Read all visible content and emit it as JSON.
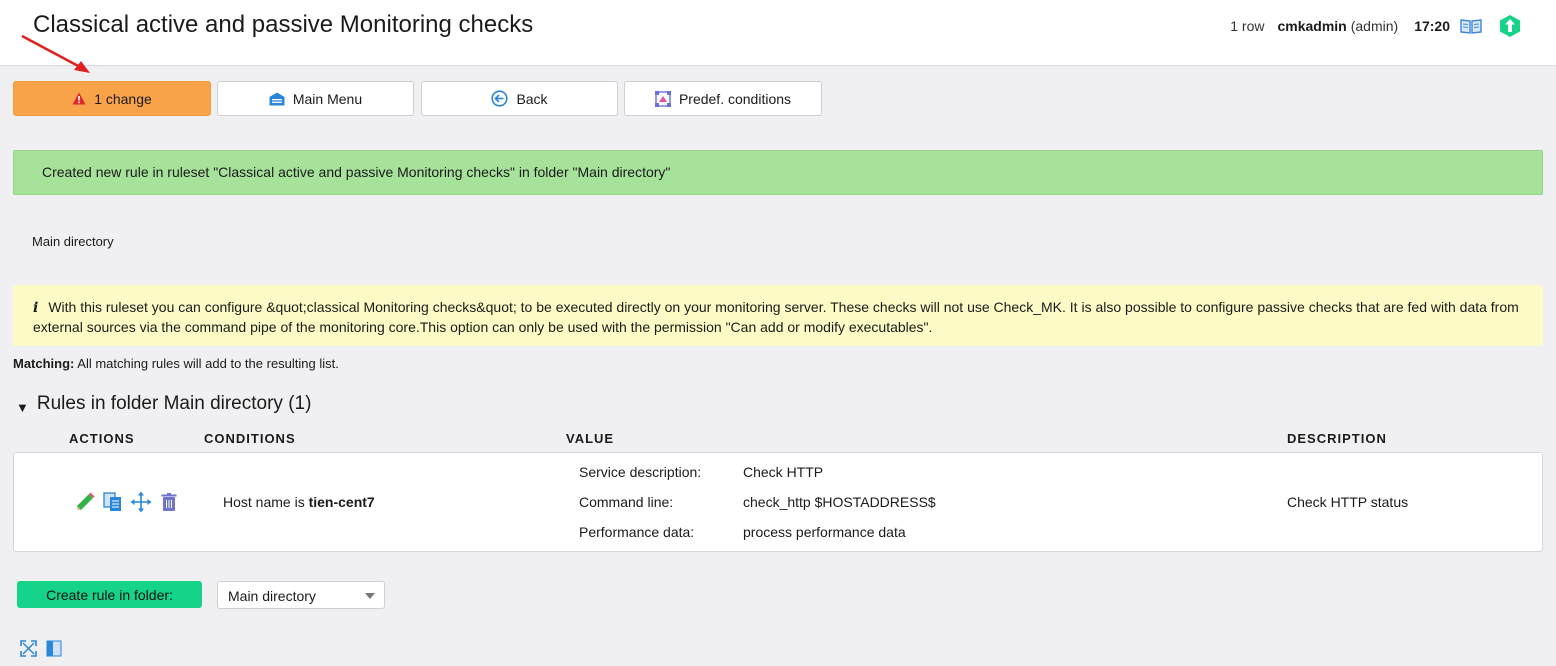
{
  "header": {
    "title": "Classical active and passive Monitoring checks",
    "row_count": "1 row",
    "user": "cmkadmin",
    "role": "(admin)",
    "time": "17:20"
  },
  "toolbar": {
    "change_label": "1 change",
    "main_menu_label": "Main Menu",
    "back_label": "Back",
    "predef_label": "Predef. conditions"
  },
  "message": {
    "success": "Created new rule in ruleset \"Classical active and passive Monitoring checks\" in folder \"Main directory\""
  },
  "breadcrumb": "Main directory",
  "info": {
    "icon": "i",
    "text": "With this ruleset you can configure &quot;classical Monitoring checks&quot; to be executed directly on your monitoring server. These checks will not use Check_MK. It is also possible to configure passive checks that are fed with data from external sources via the command pipe of the monitoring core.This option can only be used with the permission \"Can add or modify executables\"."
  },
  "matching": {
    "label": "Matching:",
    "text": "All matching rules will add to the resulting list."
  },
  "section": {
    "toggle": "▼",
    "title": "Rules in folder Main directory (1)"
  },
  "table": {
    "headers": [
      "ACTIONS",
      "CONDITIONS",
      "VALUE",
      "DESCRIPTION"
    ],
    "row": {
      "condition_prefix": "Host name is",
      "condition_host": "tien-cent7",
      "values": [
        {
          "label": "Service description:",
          "value": "Check HTTP"
        },
        {
          "label": "Command line:",
          "value": "check_http $HOSTADDRESS$"
        },
        {
          "label": "Performance data:",
          "value": "process performance data"
        }
      ],
      "description": "Check HTTP status"
    }
  },
  "footer": {
    "create_label": "Create rule in folder:",
    "folder_selected": "Main directory"
  },
  "colors": {
    "change_button": "#f8a24a",
    "success_bg": "#a7e29a",
    "info_bg": "#fcfbc6",
    "create_button": "#15d389",
    "arrow": "#e02020"
  }
}
